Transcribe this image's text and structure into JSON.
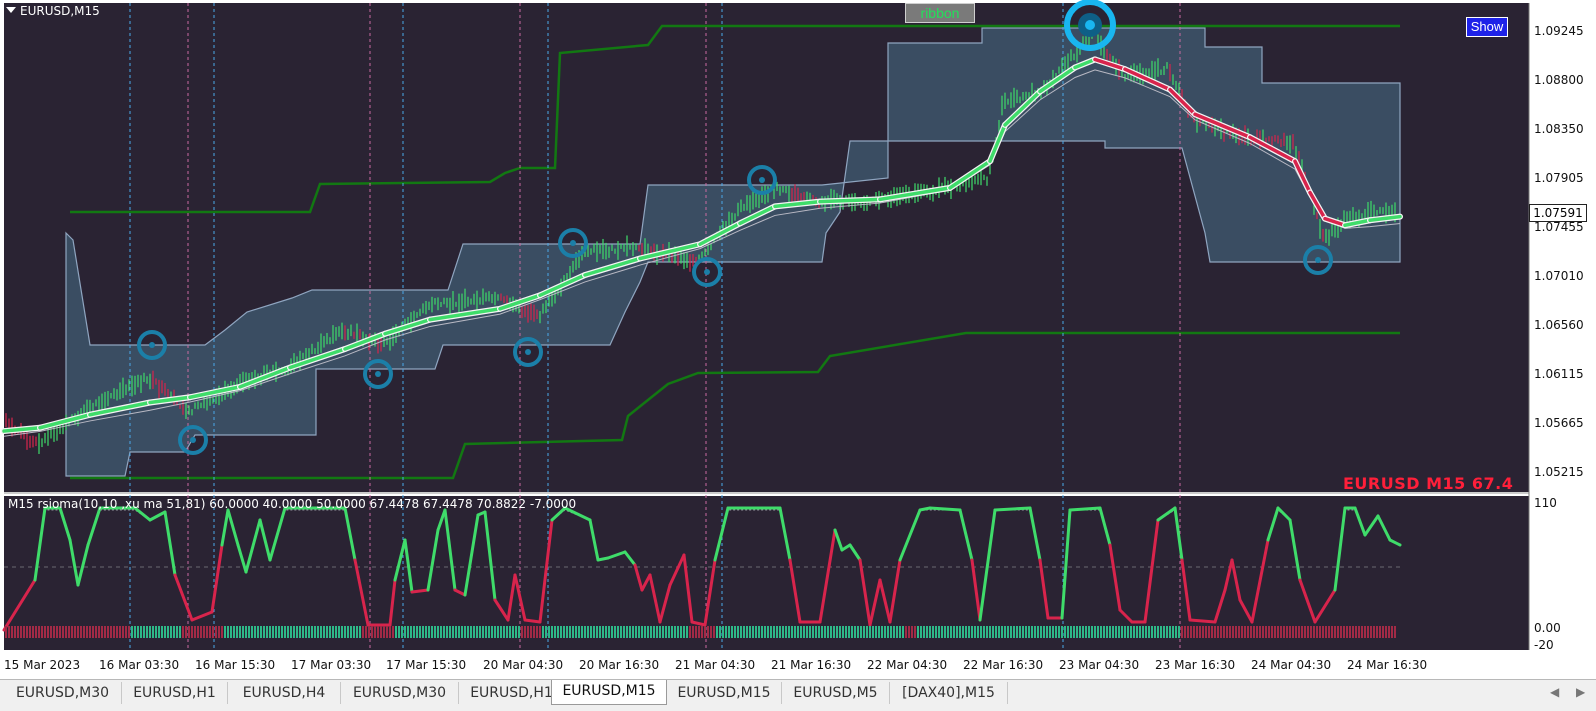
{
  "window": {
    "symbol_title": "EURUSD,M15"
  },
  "buttons": {
    "ribbon": "ribbon",
    "show": "Show"
  },
  "overlay_label": "EURUSD M15  67.4",
  "indicator_title": "M15  rsioma(10,10 ,xu ma 51,81) 60.0000 40.0000 50.0000 67.4478 67.4478 70.8822 -7.0000",
  "current_price": "1.07591",
  "price_axis": [
    "1.09245",
    "1.08800",
    "1.08350",
    "1.07905",
    "1.07455",
    "1.07010",
    "1.06560",
    "1.06115",
    "1.05665",
    "1.05215"
  ],
  "indicator_axis": [
    "110",
    "0.00",
    "-20"
  ],
  "time_axis": [
    "15 Mar 2023",
    "16 Mar 03:30",
    "16 Mar 15:30",
    "17 Mar 03:30",
    "17 Mar 15:30",
    "20 Mar 04:30",
    "20 Mar 16:30",
    "21 Mar 04:30",
    "21 Mar 16:30",
    "22 Mar 04:30",
    "22 Mar 16:30",
    "23 Mar 04:30",
    "23 Mar 16:30",
    "24 Mar 04:30",
    "24 Mar 16:30"
  ],
  "tabs": [
    {
      "label": "EURUSD,M30",
      "active": false
    },
    {
      "label": "EURUSD,H1",
      "active": false
    },
    {
      "label": "EURUSD,H4",
      "active": false
    },
    {
      "label": "EURUSD,M30",
      "active": false
    },
    {
      "label": "EURUSD,H1",
      "active": false
    },
    {
      "label": "EURUSD,M15",
      "active": true
    },
    {
      "label": "EURUSD,M15",
      "active": false
    },
    {
      "label": "EURUSD,M5",
      "active": false
    },
    {
      "label": "[DAX40],M15",
      "active": false
    }
  ],
  "colors": {
    "chart_bg": "#2a2333",
    "band_fill": "#3a4d62",
    "band_edge": "#8fa5c0",
    "bull": "#3fdc6a",
    "bear": "#d8244c",
    "dark_green": "#127812",
    "circle": "#1b7fa8"
  },
  "icons": {
    "dropdown": "triangle-down-icon",
    "scroll_left": "arrow-left-icon",
    "scroll_right": "arrow-right-icon"
  }
}
